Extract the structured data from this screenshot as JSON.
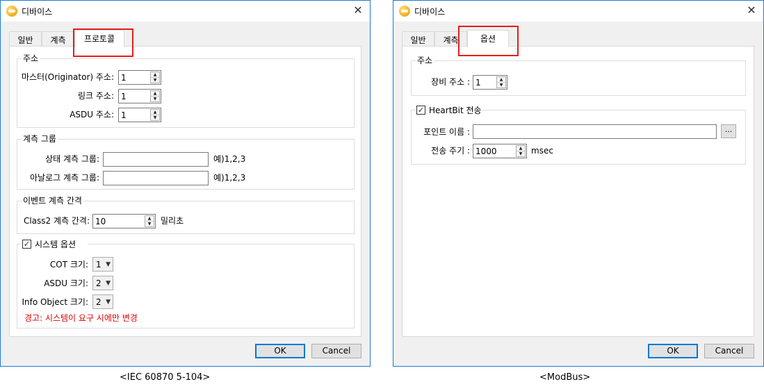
{
  "left_dialog": {
    "title": "디바이스",
    "tabs": [
      "일반",
      "계측",
      "프로토콜"
    ],
    "address_group": {
      "title": "주소",
      "master_label": "마스터(Originator) 주소:",
      "master_value": "1",
      "link_label": "링크 주소:",
      "link_value": "1",
      "asdu_label": "ASDU 주소:",
      "asdu_value": "1"
    },
    "measure_group": {
      "title": "계측 그룹",
      "status_label": "상태 계측 그룹:",
      "status_value": "",
      "status_example": "예)1,2,3",
      "analog_label": "아날로그 계측 그룹:",
      "analog_value": "",
      "analog_example": "예)1,2,3"
    },
    "event_group": {
      "title": "이벤트 계측 간격",
      "interval_label": "Class2 계측 간격:",
      "interval_value": "10",
      "unit": "밀리초"
    },
    "system_group": {
      "title": "시스템 옵션",
      "checked": true,
      "cot_label": "COT 크기:",
      "cot_value": "1",
      "asdu_label": "ASDU 크기:",
      "asdu_value": "2",
      "info_label": "Info Object 크기:",
      "info_value": "2",
      "warning": "경고: 시스템이 요구 시에만 변경"
    },
    "ok_label": "OK",
    "cancel_label": "Cancel"
  },
  "right_dialog": {
    "title": "디바이스",
    "tabs": [
      "일반",
      "계측",
      "옵션"
    ],
    "address_group": {
      "title": "주소",
      "device_label": "장비 주소 :",
      "device_value": "1"
    },
    "heartbit_group": {
      "title": "HeartBit 전송",
      "checked": true,
      "point_label": "포인트 이름 :",
      "point_value": "",
      "browse_label": "...",
      "period_label": "전송 주기 :",
      "period_value": "1000",
      "unit": "msec"
    },
    "ok_label": "OK",
    "cancel_label": "Cancel"
  },
  "captions": {
    "left": "<IEC  60870 5-104>",
    "right": "<ModBus>"
  },
  "colors": {
    "window_border": "#1c7ad4",
    "highlight": "#e41d1d",
    "warning_text": "#e00000",
    "default_button_border": "#0078d7"
  }
}
